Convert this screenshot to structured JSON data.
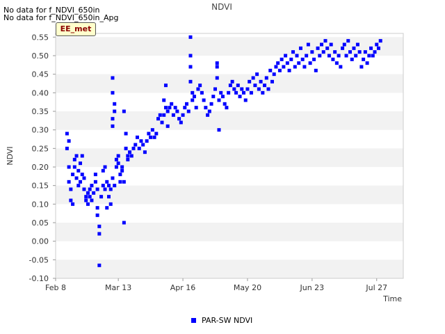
{
  "notes": [
    "No data for f_NDVI_650in",
    "No data for f_NDVI_650in_Apg"
  ],
  "badge": "EE_met",
  "chart_data": {
    "type": "scatter",
    "title": "NDVI",
    "xlabel": "Time",
    "ylabel": "NDVI",
    "x_ticks": [
      "Feb 8",
      "Mar 13",
      "Apr 16",
      "May 20",
      "Jun 23",
      "Jul 27"
    ],
    "y_ticks": [
      "-0.10",
      "-0.05",
      "0.00",
      "0.05",
      "0.10",
      "0.15",
      "0.20",
      "0.25",
      "0.30",
      "0.35",
      "0.40",
      "0.45",
      "0.50",
      "0.55"
    ],
    "xlim": [
      "Feb 8",
      "Aug 10"
    ],
    "ylim": [
      -0.1,
      0.56
    ],
    "grid": "horizontal bands",
    "legend": "bottom-center",
    "colors": {
      "series": "#0000ff",
      "band": "#f2f2f2",
      "axis": "#cccccc"
    },
    "series": [
      {
        "name": "PAR-SW NDVI",
        "points": [
          [
            "Feb 14",
            0.29
          ],
          [
            "Feb 14",
            0.25
          ],
          [
            "Feb 15",
            0.27
          ],
          [
            "Feb 15",
            0.2
          ],
          [
            "Feb 15",
            0.16
          ],
          [
            "Feb 16",
            0.14
          ],
          [
            "Feb 16",
            0.11
          ],
          [
            "Feb 17",
            0.1
          ],
          [
            "Feb 17",
            0.18
          ],
          [
            "Feb 18",
            0.22
          ],
          [
            "Feb 18",
            0.2
          ],
          [
            "Feb 19",
            0.17
          ],
          [
            "Feb 19",
            0.23
          ],
          [
            "Feb 20",
            0.19
          ],
          [
            "Feb 20",
            0.15
          ],
          [
            "Feb 21",
            0.21
          ],
          [
            "Feb 21",
            0.16
          ],
          [
            "Feb 22",
            0.23
          ],
          [
            "Feb 22",
            0.18
          ],
          [
            "Feb 23",
            0.14
          ],
          [
            "Feb 23",
            0.17
          ],
          [
            "Feb 24",
            0.12
          ],
          [
            "Feb 24",
            0.11
          ],
          [
            "Feb 25",
            0.13
          ],
          [
            "Feb 25",
            0.1
          ],
          [
            "Feb 26",
            0.14
          ],
          [
            "Feb 26",
            0.12
          ],
          [
            "Feb 27",
            0.11
          ],
          [
            "Feb 27",
            0.15
          ],
          [
            "Feb 28",
            0.13
          ],
          [
            "Mar 1",
            0.16
          ],
          [
            "Mar 1",
            0.18
          ],
          [
            "Mar 2",
            0.14
          ],
          [
            "Mar 2",
            0.09
          ],
          [
            "Mar 2",
            0.07
          ],
          [
            "Mar 3",
            0.04
          ],
          [
            "Mar 3",
            0.02
          ],
          [
            "Mar 3",
            -0.065
          ],
          [
            "Mar 4",
            0.12
          ],
          [
            "Mar 5",
            0.15
          ],
          [
            "Mar 5",
            0.19
          ],
          [
            "Mar 6",
            0.2
          ],
          [
            "Mar 6",
            0.14
          ],
          [
            "Mar 7",
            0.16
          ],
          [
            "Mar 7",
            0.09
          ],
          [
            "Mar 8",
            0.15
          ],
          [
            "Mar 8",
            0.12
          ],
          [
            "Mar 9",
            0.14
          ],
          [
            "Mar 9",
            0.1
          ],
          [
            "Mar 10",
            0.44
          ],
          [
            "Mar 10",
            0.4
          ],
          [
            "Mar 10",
            0.33
          ],
          [
            "Mar 10",
            0.31
          ],
          [
            "Mar 10",
            0.17
          ],
          [
            "Mar 11",
            0.37
          ],
          [
            "Mar 11",
            0.35
          ],
          [
            "Mar 11",
            0.15
          ],
          [
            "Mar 12",
            0.22
          ],
          [
            "Mar 12",
            0.2
          ],
          [
            "Mar 13",
            0.23
          ],
          [
            "Mar 13",
            0.21
          ],
          [
            "Mar 14",
            0.18
          ],
          [
            "Mar 14",
            0.16
          ],
          [
            "Mar 15",
            0.2
          ],
          [
            "Mar 15",
            0.19
          ],
          [
            "Mar 16",
            0.35
          ],
          [
            "Mar 16",
            0.05
          ],
          [
            "Mar 16",
            0.16
          ],
          [
            "Mar 17",
            0.29
          ],
          [
            "Mar 17",
            0.25
          ],
          [
            "Mar 18",
            0.23
          ],
          [
            "Mar 18",
            0.22
          ],
          [
            "Mar 19",
            0.24
          ],
          [
            "Mar 20",
            0.23
          ],
          [
            "Mar 21",
            0.25
          ],
          [
            "Mar 22",
            0.26
          ],
          [
            "Mar 23",
            0.28
          ],
          [
            "Mar 24",
            0.25
          ],
          [
            "Mar 25",
            0.27
          ],
          [
            "Mar 26",
            0.26
          ],
          [
            "Mar 27",
            0.24
          ],
          [
            "Mar 28",
            0.27
          ],
          [
            "Mar 29",
            0.29
          ],
          [
            "Mar 30",
            0.28
          ],
          [
            "Mar 31",
            0.3
          ],
          [
            "Apr 1",
            0.28
          ],
          [
            "Apr 2",
            0.29
          ],
          [
            "Apr 3",
            0.33
          ],
          [
            "Apr 4",
            0.34
          ],
          [
            "Apr 5",
            0.32
          ],
          [
            "Apr 6",
            0.34
          ],
          [
            "Apr 6",
            0.38
          ],
          [
            "Apr 7",
            0.42
          ],
          [
            "Apr 7",
            0.36
          ],
          [
            "Apr 8",
            0.31
          ],
          [
            "Apr 8",
            0.35
          ],
          [
            "Apr 9",
            0.36
          ],
          [
            "Apr 10",
            0.37
          ],
          [
            "Apr 11",
            0.34
          ],
          [
            "Apr 12",
            0.36
          ],
          [
            "Apr 13",
            0.35
          ],
          [
            "Apr 14",
            0.33
          ],
          [
            "Apr 15",
            0.32
          ],
          [
            "Apr 16",
            0.34
          ],
          [
            "Apr 17",
            0.36
          ],
          [
            "Apr 18",
            0.37
          ],
          [
            "Apr 19",
            0.35
          ],
          [
            "Apr 20",
            0.55
          ],
          [
            "Apr 20",
            0.5
          ],
          [
            "Apr 20",
            0.47
          ],
          [
            "Apr 20",
            0.43
          ],
          [
            "Apr 21",
            0.4
          ],
          [
            "Apr 21",
            0.38
          ],
          [
            "Apr 22",
            0.39
          ],
          [
            "Apr 23",
            0.36
          ],
          [
            "Apr 24",
            0.41
          ],
          [
            "Apr 25",
            0.42
          ],
          [
            "Apr 26",
            0.4
          ],
          [
            "Apr 27",
            0.38
          ],
          [
            "Apr 28",
            0.36
          ],
          [
            "Apr 29",
            0.34
          ],
          [
            "Apr 30",
            0.35
          ],
          [
            "May 1",
            0.37
          ],
          [
            "May 2",
            0.39
          ],
          [
            "May 3",
            0.41
          ],
          [
            "May 4",
            0.48
          ],
          [
            "May 4",
            0.47
          ],
          [
            "May 4",
            0.44
          ],
          [
            "May 5",
            0.3
          ],
          [
            "May 5",
            0.38
          ],
          [
            "May 6",
            0.4
          ],
          [
            "May 7",
            0.39
          ],
          [
            "May 8",
            0.37
          ],
          [
            "May 9",
            0.36
          ],
          [
            "May 10",
            0.4
          ],
          [
            "May 11",
            0.42
          ],
          [
            "May 12",
            0.43
          ],
          [
            "May 13",
            0.41
          ],
          [
            "May 14",
            0.4
          ],
          [
            "May 15",
            0.42
          ],
          [
            "May 16",
            0.39
          ],
          [
            "May 17",
            0.41
          ],
          [
            "May 18",
            0.4
          ],
          [
            "May 19",
            0.38
          ],
          [
            "May 20",
            0.41
          ],
          [
            "May 21",
            0.43
          ],
          [
            "May 22",
            0.4
          ],
          [
            "May 23",
            0.44
          ],
          [
            "May 24",
            0.42
          ],
          [
            "May 25",
            0.45
          ],
          [
            "May 26",
            0.41
          ],
          [
            "May 27",
            0.43
          ],
          [
            "May 28",
            0.4
          ],
          [
            "May 29",
            0.42
          ],
          [
            "May 30",
            0.44
          ],
          [
            "May 31",
            0.41
          ],
          [
            "Jun 1",
            0.46
          ],
          [
            "Jun 2",
            0.43
          ],
          [
            "Jun 3",
            0.45
          ],
          [
            "Jun 4",
            0.47
          ],
          [
            "Jun 5",
            0.48
          ],
          [
            "Jun 6",
            0.46
          ],
          [
            "Jun 7",
            0.49
          ],
          [
            "Jun 8",
            0.47
          ],
          [
            "Jun 9",
            0.5
          ],
          [
            "Jun 10",
            0.48
          ],
          [
            "Jun 11",
            0.46
          ],
          [
            "Jun 12",
            0.49
          ],
          [
            "Jun 13",
            0.51
          ],
          [
            "Jun 14",
            0.47
          ],
          [
            "Jun 15",
            0.5
          ],
          [
            "Jun 16",
            0.48
          ],
          [
            "Jun 17",
            0.52
          ],
          [
            "Jun 18",
            0.49
          ],
          [
            "Jun 19",
            0.47
          ],
          [
            "Jun 20",
            0.5
          ],
          [
            "Jun 21",
            0.53
          ],
          [
            "Jun 22",
            0.48
          ],
          [
            "Jun 23",
            0.51
          ],
          [
            "Jun 24",
            0.49
          ],
          [
            "Jun 25",
            0.46
          ],
          [
            "Jun 26",
            0.52
          ],
          [
            "Jun 27",
            0.5
          ],
          [
            "Jun 28",
            0.53
          ],
          [
            "Jun 29",
            0.51
          ],
          [
            "Jun 30",
            0.54
          ],
          [
            "Jul 1",
            0.52
          ],
          [
            "Jul 2",
            0.5
          ],
          [
            "Jul 3",
            0.53
          ],
          [
            "Jul 4",
            0.49
          ],
          [
            "Jul 5",
            0.51
          ],
          [
            "Jul 6",
            0.48
          ],
          [
            "Jul 7",
            0.5
          ],
          [
            "Jul 8",
            0.47
          ],
          [
            "Jul 9",
            0.52
          ],
          [
            "Jul 10",
            0.53
          ],
          [
            "Jul 11",
            0.5
          ],
          [
            "Jul 12",
            0.54
          ],
          [
            "Jul 13",
            0.51
          ],
          [
            "Jul 14",
            0.49
          ],
          [
            "Jul 15",
            0.52
          ],
          [
            "Jul 16",
            0.5
          ],
          [
            "Jul 17",
            0.53
          ],
          [
            "Jul 18",
            0.51
          ],
          [
            "Jul 19",
            0.47
          ],
          [
            "Jul 20",
            0.49
          ],
          [
            "Jul 21",
            0.51
          ],
          [
            "Jul 22",
            0.48
          ],
          [
            "Jul 23",
            0.5
          ],
          [
            "Jul 24",
            0.52
          ],
          [
            "Jul 25",
            0.5
          ],
          [
            "Jul 26",
            0.51
          ],
          [
            "Jul 27",
            0.53
          ],
          [
            "Jul 28",
            0.52
          ],
          [
            "Jul 29",
            0.54
          ]
        ]
      }
    ]
  }
}
